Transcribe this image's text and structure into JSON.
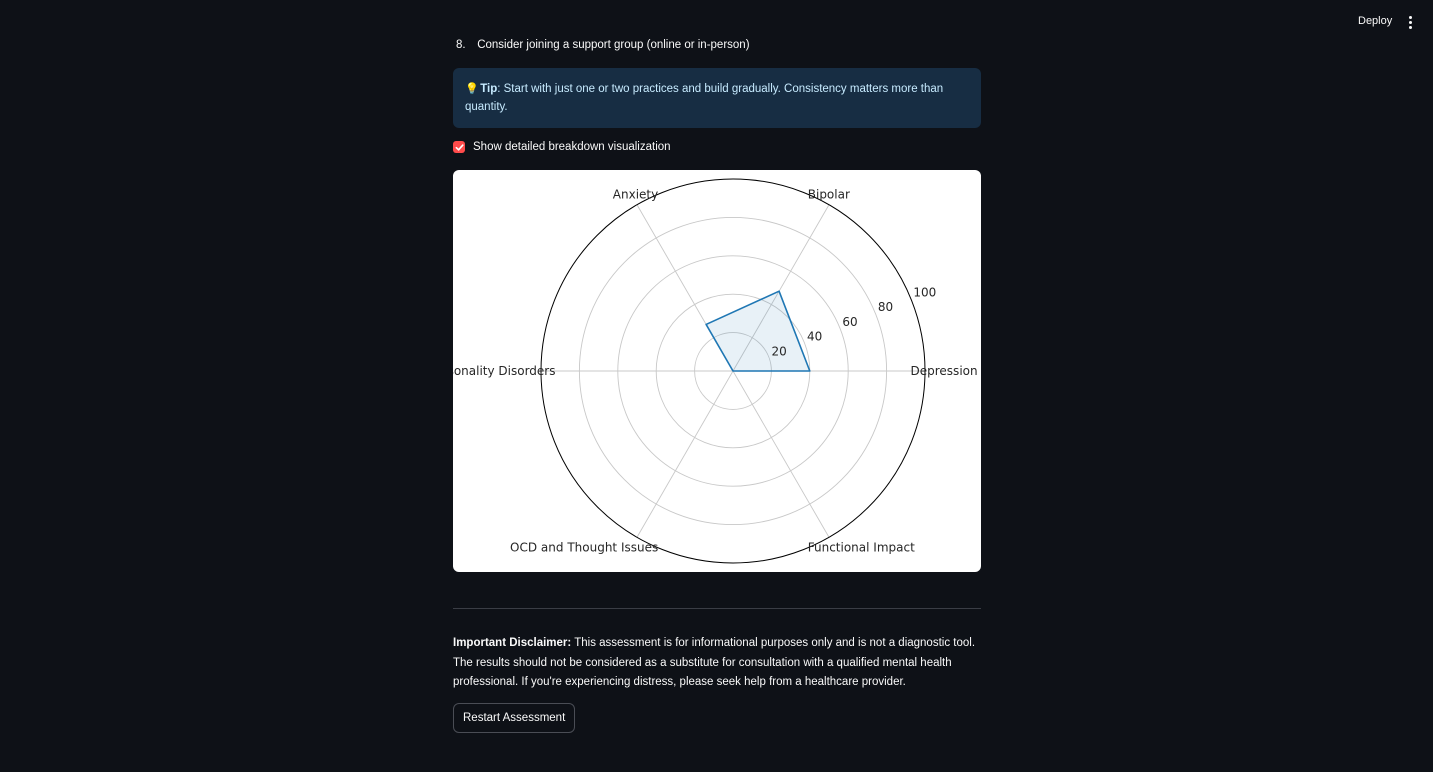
{
  "header": {
    "deploy_label": "Deploy",
    "menu_icon": "vertical-ellipsis-icon"
  },
  "list": {
    "item_number": "8.",
    "item_text": "Consider joining a support group (online or in-person)"
  },
  "tip": {
    "icon": "lightbulb-icon",
    "label": "Tip",
    "text": ": Start with just one or two practices and build gradually. Consistency matters more than quantity."
  },
  "checkbox": {
    "label": "Show detailed breakdown visualization",
    "checked": true
  },
  "chart_data": {
    "type": "radar",
    "categories": [
      "Depression",
      "Bipolar",
      "Anxiety",
      "Personality Disorders",
      "OCD and Thought Issues",
      "Functional Impact"
    ],
    "values": [
      40,
      48,
      28,
      0,
      0,
      0
    ],
    "rlim": [
      0,
      100
    ],
    "r_ticks": [
      20,
      40,
      60,
      80,
      100
    ],
    "colors": {
      "line": "#1f77b4",
      "fill": "#1f77b4"
    },
    "grid": true
  },
  "disclaimer": {
    "label": "Important Disclaimer:",
    "text": " This assessment is for informational purposes only and is not a diagnostic tool. The results should not be considered as a substitute for consultation with a qualified mental health professional. If you're experiencing distress, please seek help from a healthcare provider."
  },
  "restart": {
    "label": "Restart Assessment"
  },
  "colors": {
    "background": "#0e1117",
    "accent": "#ff4b4b",
    "tip_background": "#172d43"
  }
}
